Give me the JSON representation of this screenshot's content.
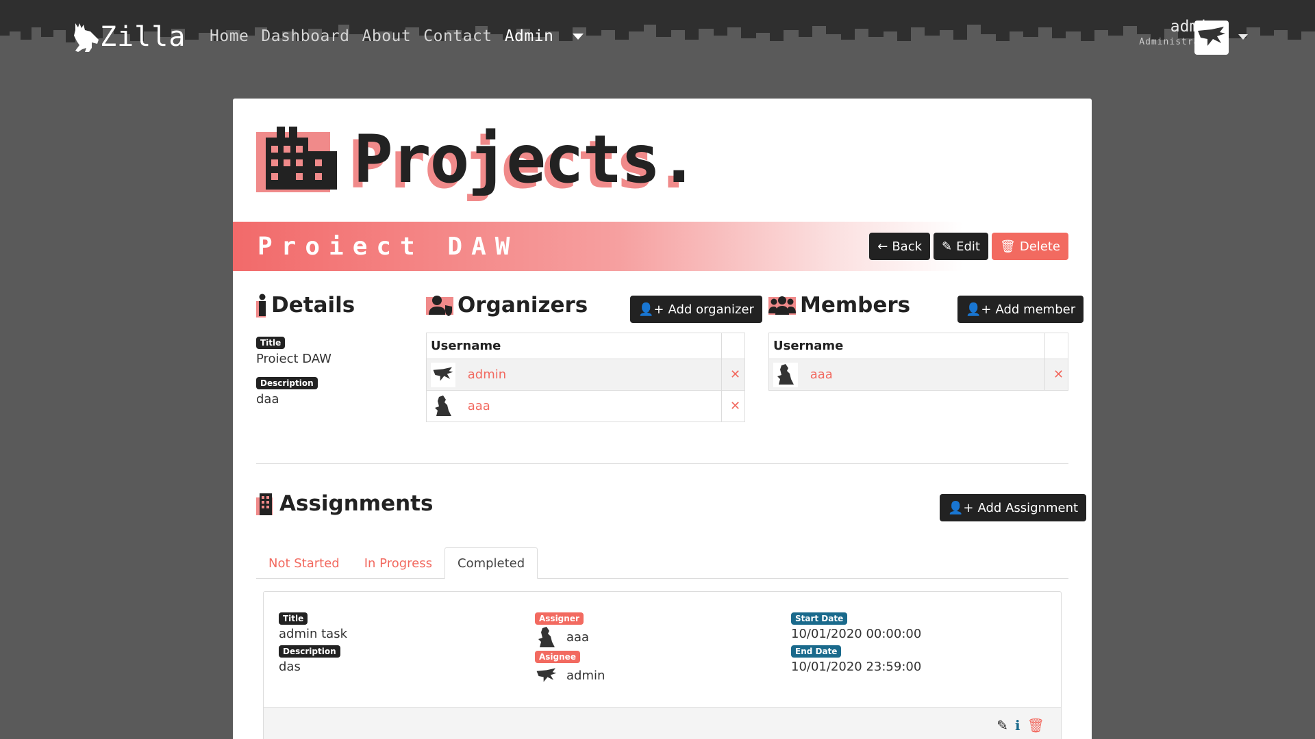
{
  "navbar": {
    "brand": "Zilla",
    "links": [
      "Home",
      "Dashboard",
      "About",
      "Contact"
    ],
    "admin_menu": "Admin",
    "user": {
      "name": "admin",
      "role": "Administrator"
    }
  },
  "page": {
    "title": "Projects."
  },
  "project": {
    "name": "Proiect DAW",
    "buttons": {
      "back": "Back",
      "edit": "Edit",
      "delete": "Delete"
    }
  },
  "details": {
    "heading": "Details",
    "title_label": "Title",
    "title_value": "Proiect DAW",
    "description_label": "Description",
    "description_value": "daa"
  },
  "organizers": {
    "heading": "Organizers",
    "add_button": "Add organizer",
    "column": "Username",
    "rows": [
      {
        "username": "admin"
      },
      {
        "username": "aaa"
      }
    ]
  },
  "members": {
    "heading": "Members",
    "add_button": "Add member",
    "column": "Username",
    "rows": [
      {
        "username": "aaa"
      }
    ]
  },
  "assignments": {
    "heading": "Assignments",
    "add_button": "Add Assignment",
    "tabs": [
      "Not Started",
      "In Progress",
      "Completed"
    ],
    "active_tab": "Completed",
    "items": [
      {
        "title_label": "Title",
        "title": "admin task",
        "description_label": "Description",
        "description": "das",
        "assigner_label": "Assigner",
        "assigner": "aaa",
        "assignee_label": "Asignee",
        "assignee": "admin",
        "start_label": "Start Date",
        "start": "10/01/2020 00:00:00",
        "end_label": "End Date",
        "end": "10/01/2020 23:59:00"
      }
    ]
  },
  "colors": {
    "accent": "#f26a60",
    "dark": "#222222",
    "navbar": "#2f2f2f",
    "background": "#5a5a5a",
    "info_badge": "#1a6a8c"
  },
  "icons": [
    "godzilla-logo-icon",
    "eagle-avatar-icon",
    "building-icon",
    "info-icon",
    "user-shield-icon",
    "users-icon",
    "user-plus-icon",
    "arrow-left-icon",
    "edit-icon",
    "trash-icon",
    "close-icon",
    "chevron-down-icon"
  ]
}
